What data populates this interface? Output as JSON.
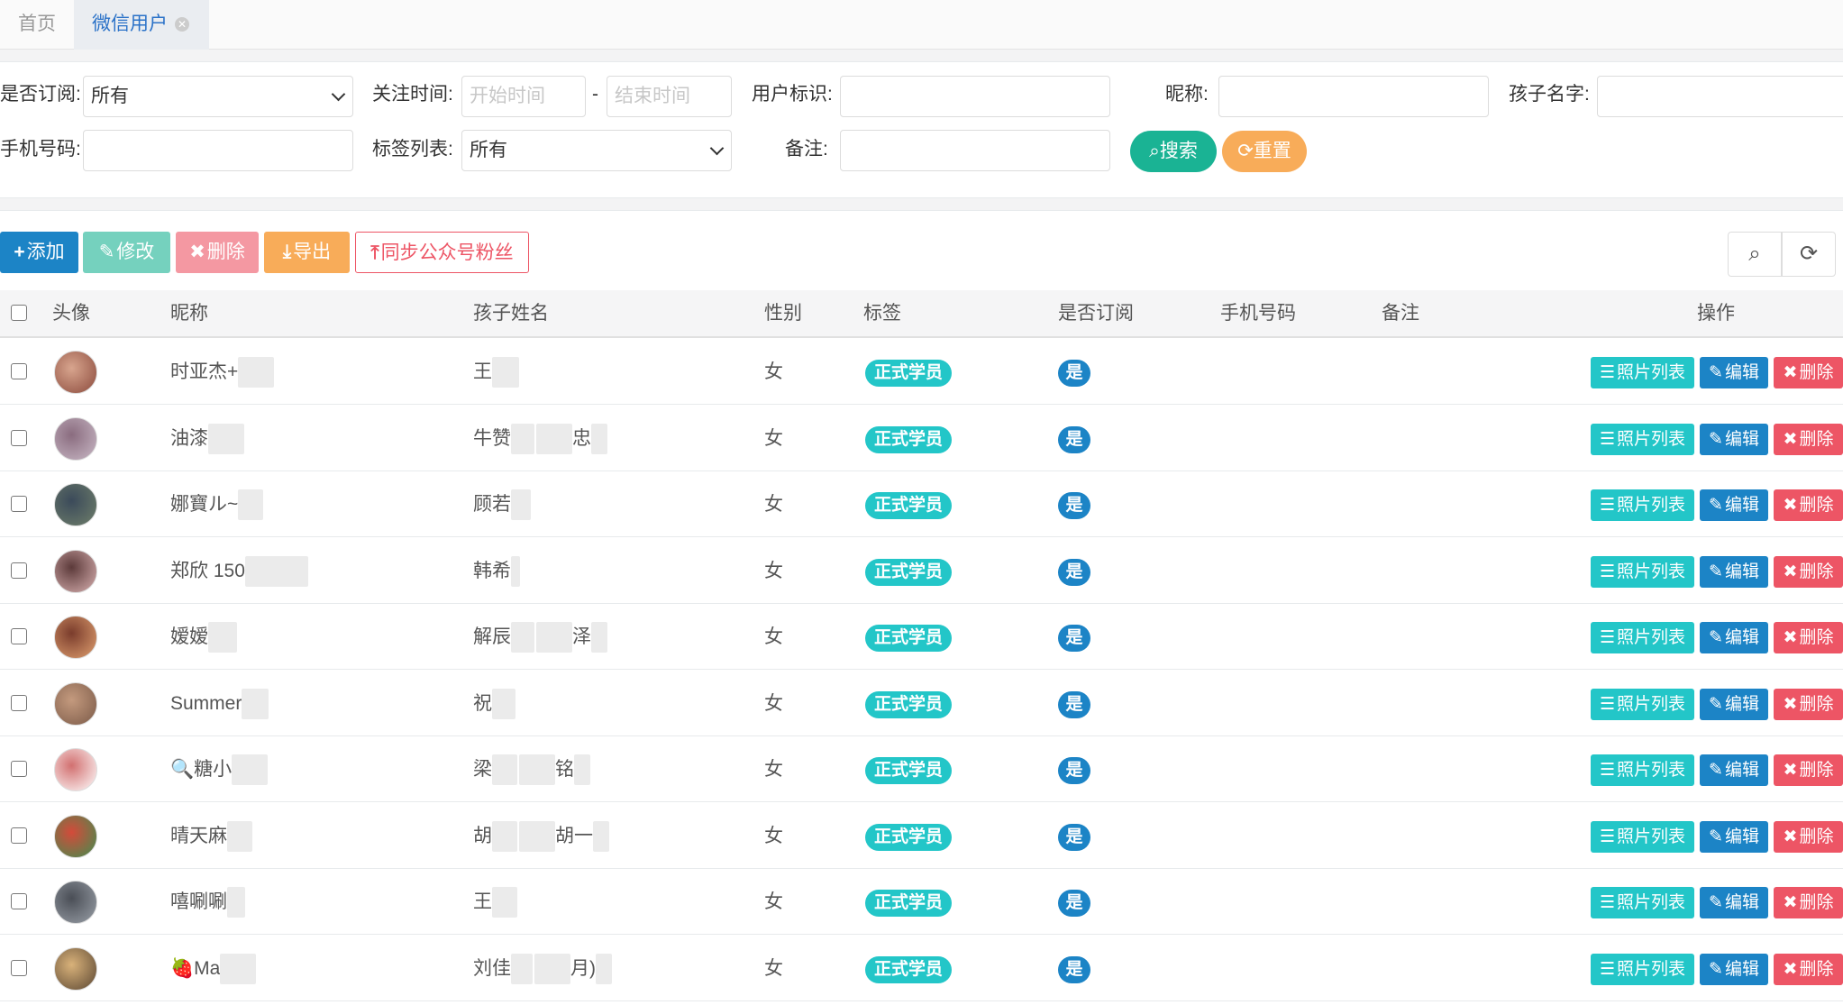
{
  "tabs": [
    {
      "label": "首页"
    },
    {
      "label": "微信用户"
    }
  ],
  "filters": {
    "subscribe_label": "是否订阅:",
    "subscribe_value": "所有",
    "follow_time_label": "关注时间:",
    "start_placeholder": "开始时间",
    "dash": "-",
    "end_placeholder": "结束时间",
    "openid_label": "用户标识:",
    "nickname_label": "昵称:",
    "child_name_label": "孩子名字:",
    "phone_label": "手机号码:",
    "tag_list_label": "标签列表:",
    "tag_list_value": "所有",
    "remark_label": "备注:",
    "search_button": "搜索",
    "reset_button": "重置"
  },
  "toolbar": {
    "add": "添加",
    "edit": "修改",
    "delete": "删除",
    "export": "导出",
    "sync": "同步公众号粉丝"
  },
  "table": {
    "headers": [
      "头像",
      "昵称",
      "孩子姓名",
      "性别",
      "标签",
      "是否订阅",
      "手机号码",
      "备注",
      "操作"
    ],
    "rows": [
      {
        "nickname": "时亚杰+",
        "child": "王",
        "gender": "女",
        "tag": "正式学员",
        "subscribed": "是"
      },
      {
        "nickname": "油漆",
        "child": "牛赞",
        "child_suffix": "忠",
        "gender": "女",
        "tag": "正式学员",
        "subscribed": "是"
      },
      {
        "nickname": "娜寶ル~",
        "child": "顾若",
        "gender": "女",
        "tag": "正式学员",
        "subscribed": "是"
      },
      {
        "nickname": "郑欣 150",
        "child": "韩希",
        "gender": "女",
        "tag": "正式学员",
        "subscribed": "是"
      },
      {
        "nickname": "嫒嫒",
        "child": "解辰",
        "child_suffix": "泽",
        "gender": "女",
        "tag": "正式学员",
        "subscribed": "是"
      },
      {
        "nickname": "Summer",
        "child": "祝",
        "gender": "女",
        "tag": "正式学员",
        "subscribed": "是"
      },
      {
        "nickname": "🔍糖小",
        "child": "梁",
        "child_suffix": "铭",
        "gender": "女",
        "tag": "正式学员",
        "subscribed": "是"
      },
      {
        "nickname": "晴天麻",
        "child": "胡",
        "child_suffix": "胡一",
        "gender": "女",
        "tag": "正式学员",
        "subscribed": "是"
      },
      {
        "nickname": "嘻唰唰",
        "child": "王",
        "gender": "女",
        "tag": "正式学员",
        "subscribed": "是"
      },
      {
        "nickname": "🍓Ma",
        "child": "刘佳",
        "child_suffix": "月)",
        "gender": "女",
        "tag": "正式学员",
        "subscribed": "是"
      }
    ],
    "actions": {
      "photos": "照片列表",
      "edit": "编辑",
      "delete": "删除"
    }
  },
  "colors": {
    "primary": "#1c84c6",
    "success": "#1ab394",
    "info": "#23c6c8",
    "danger": "#ed5565",
    "warning": "#f8ac59"
  }
}
